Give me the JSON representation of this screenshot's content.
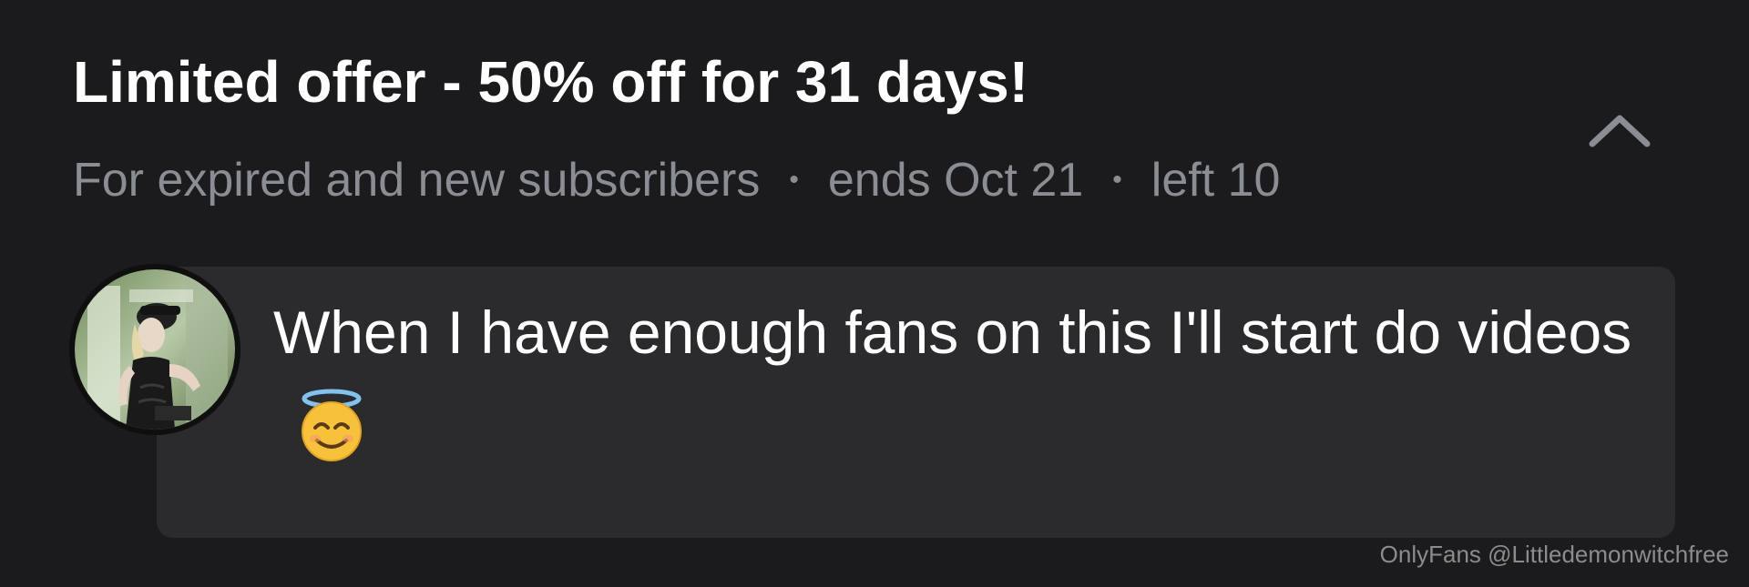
{
  "offer": {
    "title": "Limited offer - 50% off for 31 days!",
    "audience": "For expired and new subscribers",
    "ends": "ends Oct 21",
    "left": "left 10",
    "separator": "•"
  },
  "message": {
    "text": "When I have enough fans on this I'll start do videos",
    "emoji": "smiling-face-with-halo"
  },
  "watermark": "OnlyFans @Littledemonwitchfree",
  "icons": {
    "collapse": "chevron-up-icon"
  },
  "colors": {
    "background": "#1b1b1d",
    "card": "#2b2b2e",
    "muted_text": "#8a8d93",
    "primary_text": "#ffffff"
  }
}
